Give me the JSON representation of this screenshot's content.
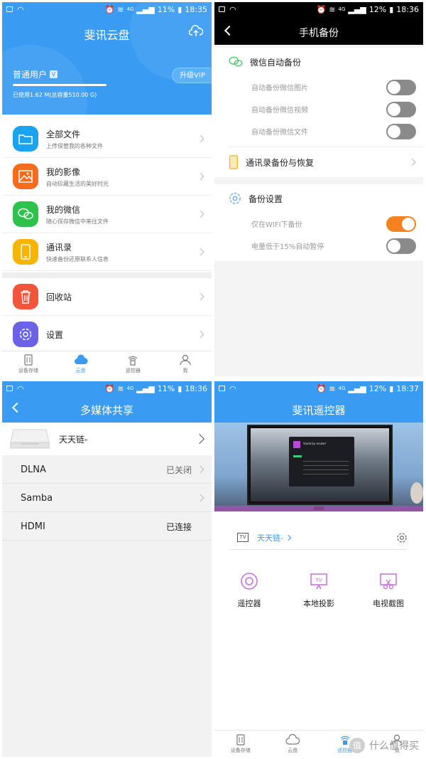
{
  "colors": {
    "primary_blue": "#3a9bf3",
    "orange_toggle": "#f5821f",
    "black_bar": "#000000"
  },
  "panel1": {
    "status": {
      "battery": "11%",
      "time": "18:35"
    },
    "title": "斐讯云盘",
    "user_label": "普通用户",
    "usage_text": "已使用1.62 M(总容量510.00 G)",
    "vip_button": "升级VIP",
    "menu": [
      {
        "title": "全部文件",
        "subtitle": "上传保管我的各种文件",
        "icon": "folder-icon",
        "color": "#1aa3f0"
      },
      {
        "title": "我的影像",
        "subtitle": "自动珍藏生活的美好时光",
        "icon": "image-icon",
        "color": "#f76b1c"
      },
      {
        "title": "我的微信",
        "subtitle": "随心保存微信中来往文件",
        "icon": "wechat-icon",
        "color": "#2cc24b"
      },
      {
        "title": "通讯录",
        "subtitle": "快速备份还原联系人信息",
        "icon": "phone-icon",
        "color": "#f7b500"
      }
    ],
    "menu2": [
      {
        "title": "回收站",
        "icon": "trash-icon",
        "color": "#f2553a"
      },
      {
        "title": "设置",
        "icon": "gear-icon",
        "color": "#6b62e8"
      }
    ],
    "tabs": [
      "设备存储",
      "云盘",
      "遥控器",
      "我"
    ]
  },
  "panel2": {
    "status": {
      "battery": "12%",
      "time": "18:36"
    },
    "title": "手机备份",
    "wechat_section": "微信自动备份",
    "wechat_rows": [
      {
        "label": "自动备份微信图片",
        "on": false
      },
      {
        "label": "自动备份微信视频",
        "on": false
      },
      {
        "label": "自动备份微信文件",
        "on": false
      }
    ],
    "contacts_label": "通讯录备份与恢复",
    "settings_section": "备份设置",
    "settings_rows": [
      {
        "label": "仅在WIFI下备份",
        "on": true
      },
      {
        "label": "电量低于15%自动暂停",
        "on": false
      }
    ]
  },
  "panel3": {
    "status": {
      "battery": "11%",
      "time": "18:36"
    },
    "title": "多媒体共享",
    "device_name": "天天链-",
    "rows": [
      {
        "label": "DLNA",
        "status": "已关闭",
        "chevron": true
      },
      {
        "label": "Samba",
        "status": "",
        "chevron": true
      },
      {
        "label": "HDMI",
        "status": "已连接",
        "chevron": false
      }
    ]
  },
  "panel4": {
    "status": {
      "battery": "12%",
      "time": "18:37"
    },
    "title": "斐讯遥控器",
    "device_name": "天天链-",
    "tv_badge": "TV",
    "tv_window_title": "Vuela by anuker",
    "actions": [
      {
        "label": "遥控器",
        "icon": "remote-icon"
      },
      {
        "label": "本地投影",
        "icon": "projection-icon"
      },
      {
        "label": "电视截图",
        "icon": "screenshot-icon"
      }
    ],
    "tabs": [
      "设备存储",
      "云盘",
      "遥控器",
      "我"
    ],
    "watermark": "什么值得买",
    "watermark_symbol": "值"
  },
  "status_network": "4G"
}
